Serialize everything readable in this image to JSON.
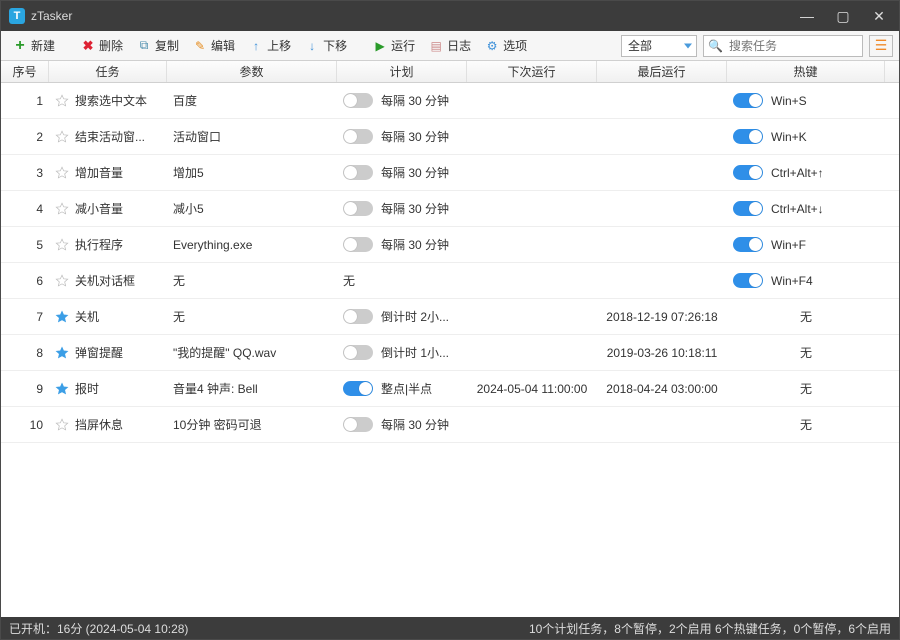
{
  "window": {
    "title": "zTasker"
  },
  "toolbar": {
    "new_label": "新建",
    "delete_label": "删除",
    "copy_label": "复制",
    "edit_label": "编辑",
    "moveup_label": "上移",
    "movedown_label": "下移",
    "run_label": "运行",
    "log_label": "日志",
    "options_label": "选项",
    "filter_value": "全部",
    "search_placeholder": "搜索任务"
  },
  "columns": {
    "index": "序号",
    "task": "任务",
    "param": "参数",
    "plan": "计划",
    "next": "下次运行",
    "last": "最后运行",
    "hotkey": "热键"
  },
  "rows": [
    {
      "index": "1",
      "starred": false,
      "task": "搜索选中文本",
      "param": "百度",
      "plan_on": false,
      "plan_text": "每隔 30 分钟",
      "next": "",
      "last": "",
      "hotkey_on": true,
      "hotkey": "Win+S"
    },
    {
      "index": "2",
      "starred": false,
      "task": "结束活动窗...",
      "param": "活动窗口",
      "plan_on": false,
      "plan_text": "每隔 30 分钟",
      "next": "",
      "last": "",
      "hotkey_on": true,
      "hotkey": "Win+K"
    },
    {
      "index": "3",
      "starred": false,
      "task": "增加音量",
      "param": "增加5",
      "plan_on": false,
      "plan_text": "每隔 30 分钟",
      "next": "",
      "last": "",
      "hotkey_on": true,
      "hotkey": "Ctrl+Alt+↑"
    },
    {
      "index": "4",
      "starred": false,
      "task": "减小音量",
      "param": "减小5",
      "plan_on": false,
      "plan_text": "每隔 30 分钟",
      "next": "",
      "last": "",
      "hotkey_on": true,
      "hotkey": "Ctrl+Alt+↓"
    },
    {
      "index": "5",
      "starred": false,
      "task": "执行程序",
      "param": "Everything.exe",
      "plan_on": false,
      "plan_text": "每隔 30 分钟",
      "next": "",
      "last": "",
      "hotkey_on": true,
      "hotkey": "Win+F"
    },
    {
      "index": "6",
      "starred": false,
      "task": "关机对话框",
      "param": "无",
      "plan_on": null,
      "plan_text": "无",
      "next": "",
      "last": "",
      "hotkey_on": true,
      "hotkey": "Win+F4"
    },
    {
      "index": "7",
      "starred": true,
      "task": "关机",
      "param": "无",
      "plan_on": false,
      "plan_text": "倒计时 2小...",
      "next": "",
      "last": "2018-12-19 07:26:18",
      "hotkey_on": null,
      "hotkey": "无"
    },
    {
      "index": "8",
      "starred": true,
      "task": "弹窗提醒",
      "param": "\"我的提醒\" QQ.wav",
      "plan_on": false,
      "plan_text": "倒计时 1小...",
      "next": "",
      "last": "2019-03-26 10:18:11",
      "hotkey_on": null,
      "hotkey": "无"
    },
    {
      "index": "9",
      "starred": true,
      "task": "报时",
      "param": "音量4 钟声: Bell",
      "plan_on": true,
      "plan_text": "整点|半点",
      "next": "2024-05-04 11:00:00",
      "last": "2018-04-24 03:00:00",
      "hotkey_on": null,
      "hotkey": "无"
    },
    {
      "index": "10",
      "starred": false,
      "task": "挡屏休息",
      "param": "10分钟 密码可退",
      "plan_on": false,
      "plan_text": "每隔 30 分钟",
      "next": "",
      "last": "",
      "hotkey_on": null,
      "hotkey": "无"
    }
  ],
  "statusbar": {
    "left": "已开机：16分 (2024-05-04 10:28)",
    "right": "10个计划任务，8个暂停，2个启用    6个热键任务，0个暂停，6个启用"
  }
}
